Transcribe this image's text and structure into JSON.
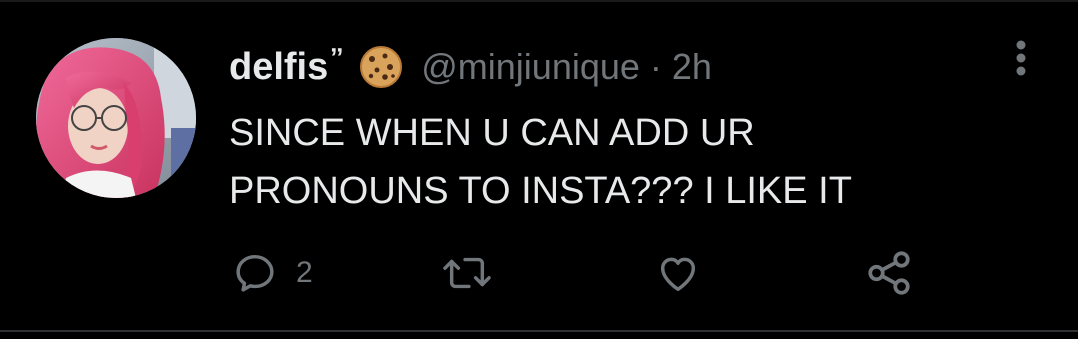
{
  "tweet": {
    "display_name": "delfis",
    "name_mark": "ˮ",
    "handle": "@minjiunique",
    "separator": "·",
    "time": "2h",
    "text_lines": [
      "SINCE WHEN U CAN ADD UR",
      "PRONOUNS TO INSTA??? I LIKE IT"
    ]
  },
  "actions": {
    "reply_icon": "reply-icon",
    "reply_count": "2",
    "retweet_icon": "retweet-icon",
    "like_icon": "heart-icon",
    "share_icon": "share-icon"
  },
  "icons": {
    "more": "more-vertical-icon",
    "emoji": "cookie-icon",
    "avatar": "avatar"
  },
  "colors": {
    "background": "#000000",
    "primary_text": "#e7e9ea",
    "secondary_text": "#71767b",
    "divider": "#2f3336",
    "avatar_hair": "#e0457b"
  }
}
